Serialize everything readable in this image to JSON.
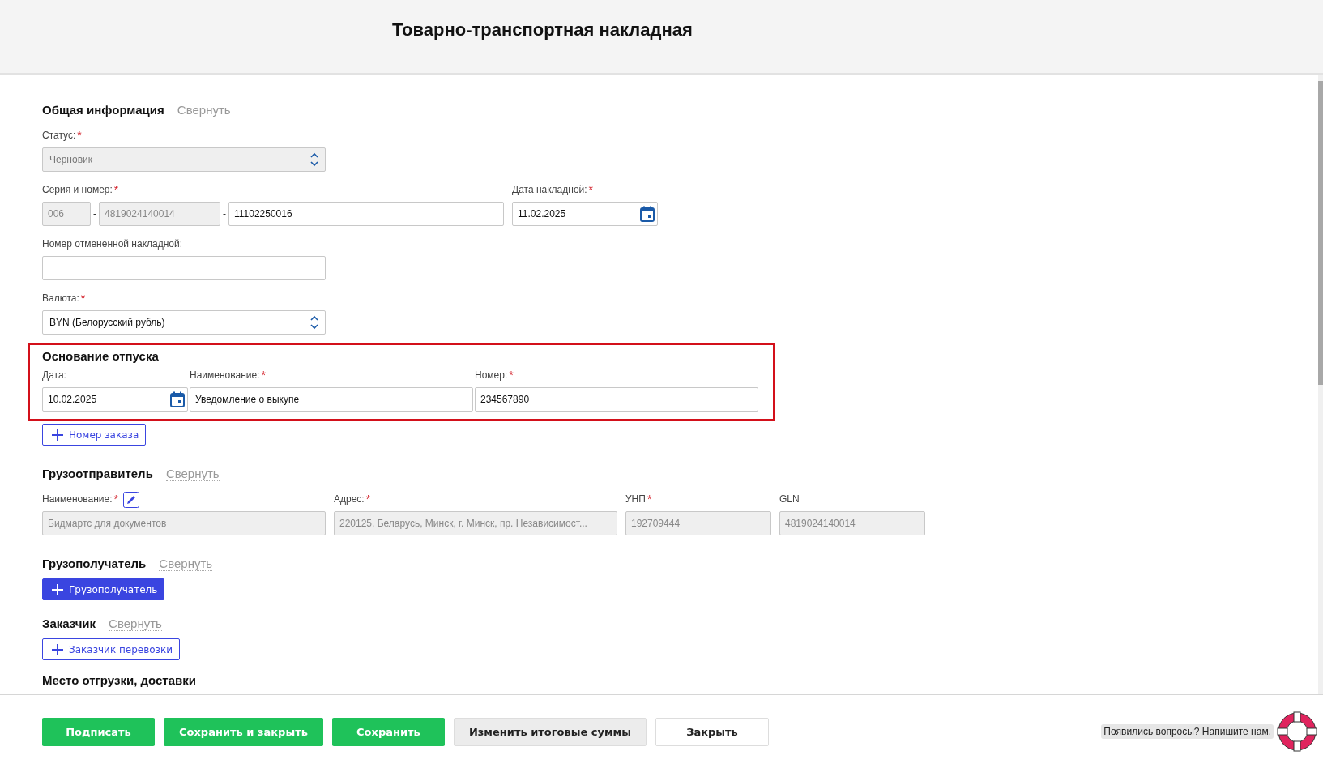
{
  "header": {
    "title": "Товарно-транспортная накладная"
  },
  "general": {
    "heading": "Общая информация",
    "collapse": "Свернуть",
    "status": {
      "label": "Статус:",
      "asterisk": "*",
      "value": "Черновик",
      "disabled": true
    },
    "series": {
      "label": "Серия и номер:",
      "asterisk": "*",
      "separators": [
        "-",
        "-"
      ],
      "parts": [
        {
          "value": "006",
          "disabled": true
        },
        {
          "value": "4819024140014",
          "disabled": true
        },
        {
          "value": "11102250016",
          "disabled": false
        }
      ]
    },
    "invoice_date": {
      "label": "Дата накладной:",
      "asterisk": "*",
      "value": "11.02.2025"
    },
    "cancelled_number": {
      "label": "Номер отмененной накладной:"
    },
    "currency": {
      "label": "Валюта:",
      "asterisk": "*",
      "value": "BYN (Белорусский рубль)",
      "disabled": false
    }
  },
  "release_basis": {
    "heading": "Основание отпуска",
    "highlighted": true,
    "fields": [
      {
        "label": "Дата:",
        "value": "10.02.2025",
        "kind": "date"
      },
      {
        "label": "Наименование:",
        "asterisk": "*",
        "value": "Уведомление о выкупе",
        "kind": "text"
      },
      {
        "label": "Номер:",
        "asterisk": "*",
        "value": "234567890",
        "kind": "text"
      }
    ],
    "add_button": {
      "label": "Номер заказа",
      "primary": false
    }
  },
  "shipper": {
    "heading": "Грузоотправитель",
    "collapse": "Свернуть",
    "fields": [
      {
        "label": "Наименование:",
        "asterisk": "*",
        "editable": true,
        "value": "Бидмартс для документов",
        "disabled": true,
        "kind": "wide"
      },
      {
        "label": "Адрес:",
        "asterisk": "*",
        "value": "220125, Беларусь, Минск, г. Минск, пр. Независимост...",
        "disabled": true,
        "kind": "wide"
      },
      {
        "label": "УНП",
        "asterisk": "*",
        "value": "192709444",
        "disabled": true,
        "kind": "narrow"
      },
      {
        "label": "GLN",
        "value": "4819024140014",
        "disabled": true,
        "kind": "narrow"
      }
    ]
  },
  "consignee": {
    "heading": "Грузополучатель",
    "collapse": "Свернуть",
    "add_button": {
      "label": "Грузополучатель",
      "primary": true
    }
  },
  "customer": {
    "heading": "Заказчик",
    "collapse": "Свернуть",
    "add_button": {
      "label": "Заказчик перевозки",
      "primary": false
    }
  },
  "places": {
    "heading": "Место отгрузки, доставки"
  },
  "footer": {
    "buttons": [
      {
        "label": "Подписать",
        "kind": "success"
      },
      {
        "label": "Сохранить и закрыть",
        "kind": "success"
      },
      {
        "label": "Сохранить",
        "kind": "success"
      },
      {
        "label": "Изменить итоговые суммы",
        "kind": "secondary"
      },
      {
        "label": "Закрыть",
        "kind": "plain"
      }
    ],
    "help": {
      "text": "Появились вопросы? Напишите нам."
    }
  }
}
